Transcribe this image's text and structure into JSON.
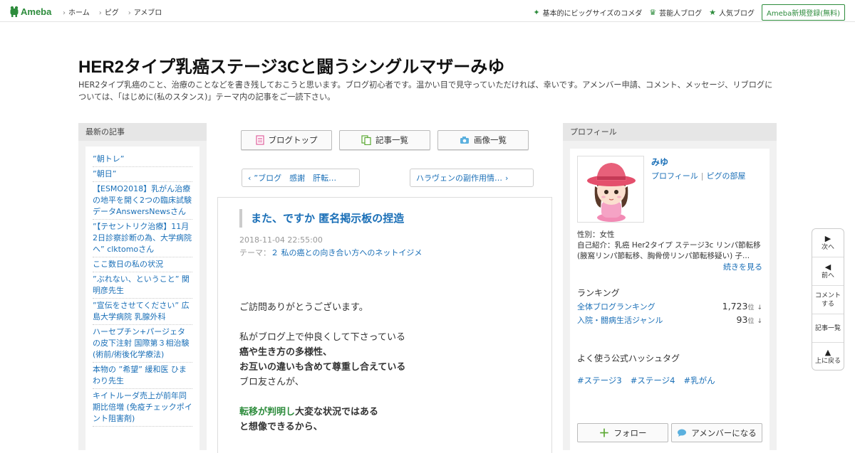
{
  "topbar": {
    "logo": "Ameba",
    "nav": [
      "ホーム",
      "ピグ",
      "アメブロ"
    ],
    "right_links": [
      {
        "icon": "clover-icon",
        "label": "基本的にビッグサイズのコメダ"
      },
      {
        "icon": "crown-icon",
        "label": "芸能人ブログ"
      },
      {
        "icon": "star-icon",
        "label": "人気ブログ"
      }
    ],
    "signup": "Ameba新規登録(無料)"
  },
  "header": {
    "title": "HER2タイプ乳癌ステージ3Cと闘うシングルマザーみゆ",
    "description": "HER2タイプ乳癌のこと、治療のことなどを書き残しておこうと思います。ブログ初心者です。温かい目で見守っていただければ、幸いです。アメンバー申請、コメント、メッセージ、リブログについては、「はじめに(私のスタンス)」テーマ内の記事をご一読下さい。"
  },
  "left": {
    "heading": "最新の記事",
    "items": [
      "”朝トレ”",
      "”朝日”",
      "【ESMO2018】乳がん治療の地平を開く2つの臨床試験データAnswersNewsさん",
      "”【テセントリク治療】11月2日診察診断の為、大学病院へ” clktomoさん",
      "ここ数日の私の状況",
      "”ぶれない、ということ” 関明彦先生",
      "”宣伝をさせてください” 広島大学病院 乳腺外科",
      "ハーセプチン+パージェタの皮下注射 国際第３相治験(術前/術後化学療法)",
      "本物の ”希望” 緩和医 ひまわり先生",
      "キイトルーダ売上が前年同期比倍増 (免疫チェックポイント阻害剤)"
    ]
  },
  "center": {
    "buttons": [
      {
        "icon": "document-icon",
        "label": "ブログトップ"
      },
      {
        "icon": "copy-icon",
        "label": "記事一覧"
      },
      {
        "icon": "camera-icon",
        "label": "画像一覧"
      }
    ],
    "prev": "”ブログ　感謝　肝転…",
    "next": "ハラヴェンの副作用情…",
    "article": {
      "title": "また、ですか 匿名掲示板の捏造",
      "date": "2018-11-04 22:55:00",
      "theme_label": "テーマ：",
      "theme": "２ 私の癌との向き合い方へのネットイジメ",
      "lines": [
        {
          "text": "ご訪問ありがとうございます。",
          "style": ""
        },
        {
          "text": "",
          "style": ""
        },
        {
          "text": "私がブログ上で仲良くして下さっている",
          "style": ""
        },
        {
          "text": "癌や生き方の多様性、",
          "style": "b"
        },
        {
          "text": "お互いの違いも含めて尊重し合えている",
          "style": "b"
        },
        {
          "text": "ブロ友さんが、",
          "style": ""
        },
        {
          "text": "",
          "style": ""
        },
        {
          "green": "転移が判明し",
          "text": "大変な状況ではある",
          "style": "b"
        },
        {
          "text": "と想像できるから、",
          "style": "b"
        }
      ]
    }
  },
  "right": {
    "heading": "プロフィール",
    "name": "みゆ",
    "link_profile": "プロフィール",
    "link_room": "ピグの部屋",
    "gender": "性別：女性",
    "intro": "自己紹介：乳癌 Her2タイプ ステージ3c リンパ節転移 (腋窩リンパ節転移、胸骨傍リンパ節転移疑い) 子...",
    "more": "続きを見る",
    "ranking_title": "ランキング",
    "rankings": [
      {
        "label": "全体ブログランキング",
        "value": "1,723",
        "unit": "位",
        "trend": "↓"
      },
      {
        "label": "入院・闘病生活ジャンル",
        "value": "93",
        "unit": "位",
        "trend": "↓"
      }
    ],
    "hashtag_title": "よく使う公式ハッシュタグ",
    "hashtags": [
      "#ステージ3",
      "#ステージ4",
      "#乳がん"
    ],
    "follow": "フォロー",
    "amember": "アメンバーになる"
  },
  "sidenav": [
    {
      "arrow": "▶",
      "label": "次へ"
    },
    {
      "arrow": "◀",
      "label": "前へ"
    },
    {
      "arrow": "",
      "label": "コメントする"
    },
    {
      "arrow": "",
      "label": "記事一覧"
    },
    {
      "arrow": "▲",
      "label": "上に戻る"
    }
  ],
  "colors": {
    "brand": "#2d8c3c",
    "link": "#1a6fb7"
  }
}
